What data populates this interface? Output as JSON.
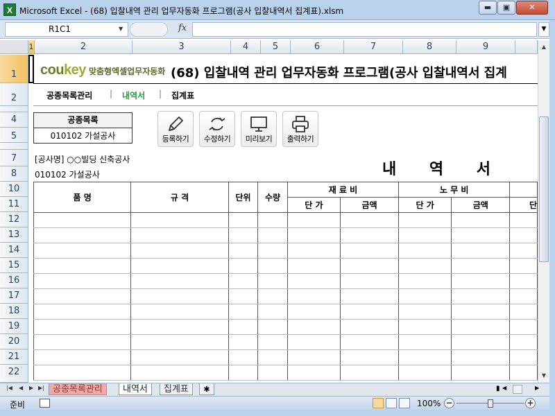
{
  "window": {
    "app_icon": "X",
    "title": "Microsoft Excel - (68) 입찰내역 관리 업무자동화 프로그램(공사 입찰내역서 집계표).xlsm",
    "minimize": "▬",
    "maximize": "▣",
    "close": "✕"
  },
  "formula_bar": {
    "name_box": "R1C1",
    "fx_label": "fx",
    "formula": ""
  },
  "columns": [
    "1",
    "2",
    "3",
    "4",
    "5",
    "6",
    "7",
    "8",
    "9"
  ],
  "rows": [
    "1",
    "2",
    "4",
    "5",
    "7",
    "8",
    "10",
    "11",
    "12",
    "13",
    "14",
    "15",
    "16",
    "17",
    "18",
    "19",
    "20",
    "21",
    "22"
  ],
  "sheet": {
    "logo_cou": "cou",
    "logo_key": "key",
    "logo_tagline": "맞춤형엑셀업무자동화",
    "program_title": "(68) 입찰내역 관리 업무자동화 프로그램(공사 입찰내역서 집계",
    "nav": {
      "item1": "공종목록관리",
      "item2": "내역서",
      "item3": "집계표",
      "separator": "|"
    },
    "category_box": {
      "header": "공종목록",
      "value": "010102  가설공사"
    },
    "buttons": {
      "register": "등록하기",
      "modify": "수정하기",
      "preview": "미리보기",
      "print": "출력하기"
    },
    "project_line": "[공사명] ○○빌딩 신축공사",
    "category_line": "010102  가설공사",
    "doc_title": "내 역 서",
    "table": {
      "col_item": "품  명",
      "col_spec": "규  격",
      "col_unit": "단위",
      "col_qty": "수량",
      "group_material": "재 료 비",
      "group_labor": "노 무 비",
      "sub_unit_price": "단 가",
      "sub_amount": "금액",
      "sub_labor_unit_price": "단 가",
      "sub_labor_amount": "금액",
      "sub_cut": "단"
    }
  },
  "tabs": {
    "tab1": "공종목록관리",
    "tab2": "내역서",
    "tab3": "집계표"
  },
  "status": {
    "ready": "준비",
    "zoom": "100%",
    "zoom_minus": "−",
    "zoom_plus": "+"
  }
}
